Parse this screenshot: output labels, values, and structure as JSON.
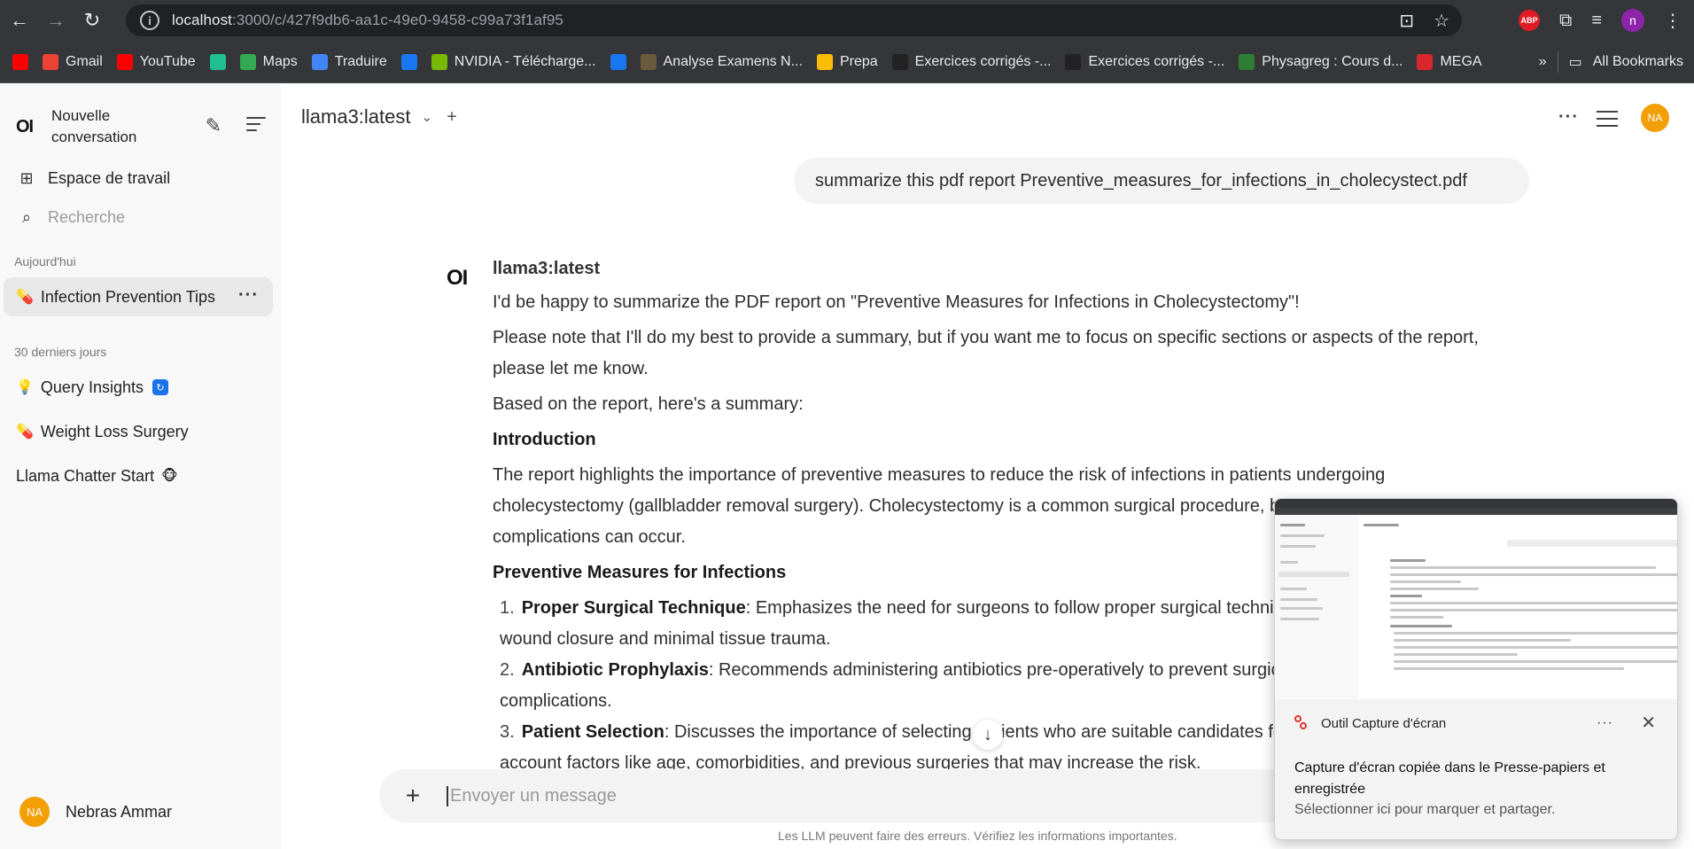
{
  "browser": {
    "url_host": "localhost",
    "url_path": ":3000/c/427f9db6-aa1c-49e0-9458-c99a73f1af95",
    "bookmarks": [
      {
        "label": "",
        "icon": "youtube-logo",
        "color": "#ff0000"
      },
      {
        "label": "Gmail",
        "icon": "gmail-logo",
        "color": "#ea4335"
      },
      {
        "label": "YouTube",
        "icon": "youtube-logo",
        "color": "#ff0000"
      },
      {
        "label": "",
        "icon": "f-logo",
        "color": "#1fbf8f"
      },
      {
        "label": "Maps",
        "icon": "maps-pin",
        "color": "#34a853"
      },
      {
        "label": "Traduire",
        "icon": "translate-logo",
        "color": "#4285f4"
      },
      {
        "label": "",
        "icon": "facebook-logo",
        "color": "#1877f2"
      },
      {
        "label": "NVIDIA - Télécharge...",
        "icon": "nvidia-logo",
        "color": "#76b900"
      },
      {
        "label": "",
        "icon": "facebook-logo",
        "color": "#1877f2"
      },
      {
        "label": "Analyse Examens N...",
        "icon": "doc-logo",
        "color": "#6b5b3e"
      },
      {
        "label": "Prepa",
        "icon": "drive-logo",
        "color": "#fbbc04"
      },
      {
        "label": "Exercices corrigés -...",
        "icon": "triangle-logo",
        "color": "#222222"
      },
      {
        "label": "Exercices corrigés -...",
        "icon": "triangle-logo",
        "color": "#222222"
      },
      {
        "label": "Physagreg : Cours d...",
        "icon": "leaf-logo",
        "color": "#2e7d32"
      },
      {
        "label": "MEGA",
        "icon": "mega-logo",
        "color": "#d9272e"
      }
    ],
    "all_bookmarks": "All Bookmarks",
    "more": "»"
  },
  "sidebar": {
    "new_chat": "Nouvelle conversation",
    "workspace": "Espace de travail",
    "search_placeholder": "Recherche",
    "section_today": "Aujourd'hui",
    "section_30days": "30 derniers jours",
    "chats_today": [
      {
        "emoji": "💊",
        "title": "Infection Prevention Tips"
      }
    ],
    "chats_30": [
      {
        "emoji": "💡",
        "title": "Query Insights",
        "badge": "🔄"
      },
      {
        "emoji": "💊",
        "title": "Weight Loss Surgery"
      },
      {
        "emoji": "",
        "title": "Llama Chatter Start",
        "badge": "🐵"
      }
    ],
    "user_initials": "NA",
    "user_name": "Nebras Ammar"
  },
  "topbar": {
    "model": "llama3:latest",
    "avatar": "NA"
  },
  "conversation": {
    "user_message": "summarize this pdf report Preventive_measures_for_infections_in_cholecystect.pdf",
    "assistant_model": "llama3:latest",
    "p1": "I'd be happy to summarize the PDF report on \"Preventive Measures for Infections in Cholecystectomy\"!",
    "p2": "Please note that I'll do my best to provide a summary, but if you want me to focus on specific sections or aspects of the report, please let me know.",
    "p3": "Based on the report, here's a summary:",
    "h_intro": "Introduction",
    "p4": "The report highlights the importance of preventive measures to reduce the risk of infections in patients undergoing cholecystectomy (gallbladder removal surgery). Cholecystectomy is a common surgical procedure, but postoperative complications can occur.",
    "h_measures": "Preventive Measures for Infections",
    "items": [
      {
        "num": "1.",
        "title": "Proper Surgical Technique",
        "text": ": Emphasizes the need for surgeons to follow proper surgical techniques, including meticulous wound closure and minimal tissue trauma."
      },
      {
        "num": "2.",
        "title": "Antibiotic Prophylaxis",
        "text": ": Recommends administering antibiotics pre-operatively to prevent surgical site infections and other complications."
      },
      {
        "num": "3.",
        "title": "Patient Selection",
        "text": ": Discusses the importance of selecting patients who are suitable candidates for surgery, taking into account factors like age, comorbidities, and previous surgeries that may increase the risk."
      }
    ]
  },
  "input": {
    "placeholder": "Envoyer un message",
    "disclaimer": "Les LLM peuvent faire des erreurs. Vérifiez les informations importantes."
  },
  "toast": {
    "app": "Outil Capture d'écran",
    "title": "Capture d'écran copiée dans le Presse-papiers et enregistrée",
    "subtitle": "Sélectionner ici pour marquer et partager."
  }
}
